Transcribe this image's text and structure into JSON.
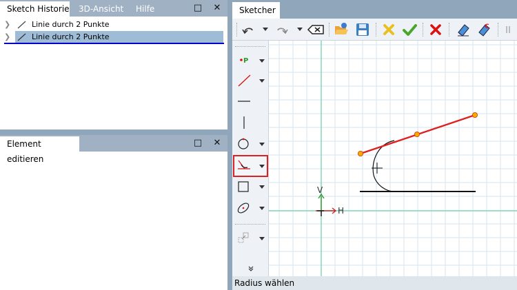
{
  "history_panel": {
    "tabs": [
      "Sketch Historie",
      "3D-Ansicht",
      "Hilfe"
    ],
    "items": [
      {
        "label": "Linie durch 2 Punkte",
        "selected": false
      },
      {
        "label": "Linie durch 2 Punkte",
        "selected": true
      }
    ],
    "maximize_icon": "□",
    "close_icon": "✕"
  },
  "edit_panel": {
    "tab": "Element editieren",
    "maximize_icon": "□",
    "close_icon": "✕"
  },
  "sketcher": {
    "tab": "Sketcher",
    "status_text": "Radius wählen",
    "toolbar_icons": [
      "undo-icon",
      "undo-dropdown-icon",
      "redo-icon",
      "redo-dropdown-icon",
      "delete-backspace-icon",
      "open-folder-icon",
      "save-icon",
      "cancel-yellow-x-icon",
      "confirm-checkmark-icon",
      "abort-red-x-icon",
      "eraser-icon",
      "eraser-c-icon"
    ],
    "side_tools": [
      "point-icon",
      "line-icon",
      "horizontal-line-icon",
      "vertical-line-icon",
      "circle-icon",
      "fillet-icon",
      "rectangle-icon",
      "ellipse-icon",
      "transform-icon",
      "more-tools-icon"
    ],
    "active_tool": "fillet-icon",
    "axis_labels": {
      "vertical": "V",
      "horizontal": "H"
    },
    "colors": {
      "grid": "#d4e6f0",
      "axis": "#7fd2b4",
      "selected_line": "#e02020",
      "point": "#ffa500",
      "active_border": "#e02020"
    }
  }
}
